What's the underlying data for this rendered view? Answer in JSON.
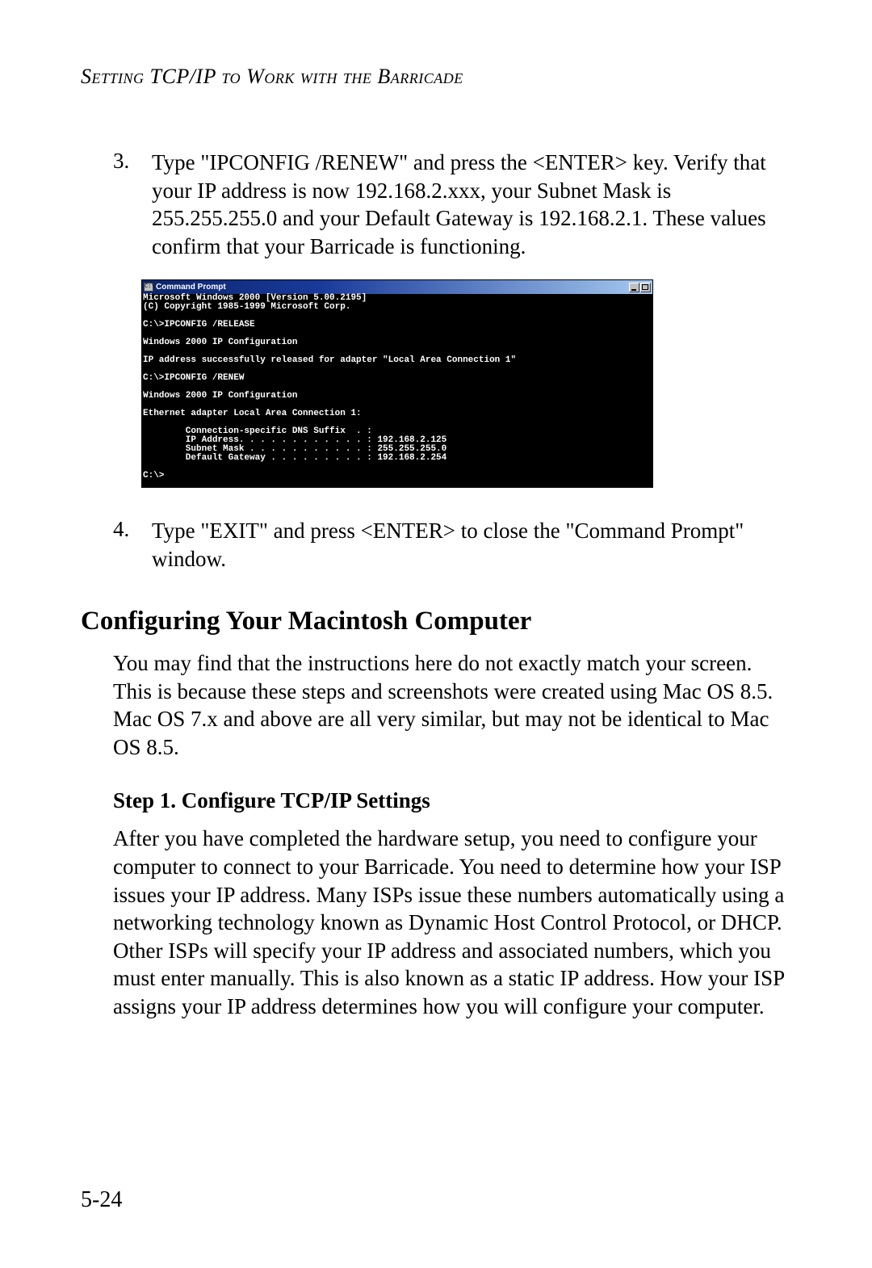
{
  "header": "Setting TCP/IP to Work with the Barricade",
  "step3": {
    "num": "3.",
    "text": "Type \"IPCONFIG /RENEW\" and press the <ENTER> key. Verify that your IP address is now 192.168.2.xxx, your Subnet Mask is 255.255.255.0 and your Default Gateway is 192.168.2.1. These values confirm that your Barricade is functioning."
  },
  "cmd": {
    "icon_label": "C:\\",
    "title": "Command Prompt",
    "lines": "Microsoft Windows 2000 [Version 5.00.2195]\n(C) Copyright 1985-1999 Microsoft Corp.\n\nC:\\>IPCONFIG /RELEASE\n\nWindows 2000 IP Configuration\n\nIP address successfully released for adapter \"Local Area Connection 1\"\n\nC:\\>IPCONFIG /RENEW\n\nWindows 2000 IP Configuration\n\nEthernet adapter Local Area Connection 1:\n\n        Connection-specific DNS Suffix  . :\n        IP Address. . . . . . . . . . . . : 192.168.2.125\n        Subnet Mask . . . . . . . . . . . : 255.255.255.0\n        Default Gateway . . . . . . . . . : 192.168.2.254\n\nC:\\>"
  },
  "step4": {
    "num": "4.",
    "text": "Type \"EXIT\" and press <ENTER> to close the \"Command Prompt\" window."
  },
  "h2": "Configuring Your Macintosh Computer",
  "p1": "You may find that the instructions here do not exactly match your screen. This is because these steps and screenshots were created using Mac OS 8.5. Mac OS 7.x and above are all very similar, but may not be identical to Mac OS 8.5.",
  "h3": "Step 1. Configure TCP/IP Settings",
  "p2": "After you have completed the hardware setup, you need to configure your computer to connect to your Barricade. You need to determine how your ISP issues your IP address. Many ISPs issue these numbers automatically using a networking technology known as Dynamic Host Control Protocol, or DHCP. Other ISPs will specify your IP address and associated numbers, which you must enter manually. This is also known as a static IP address. How your ISP assigns your IP address determines how you will configure your computer.",
  "page_number": "5-24"
}
